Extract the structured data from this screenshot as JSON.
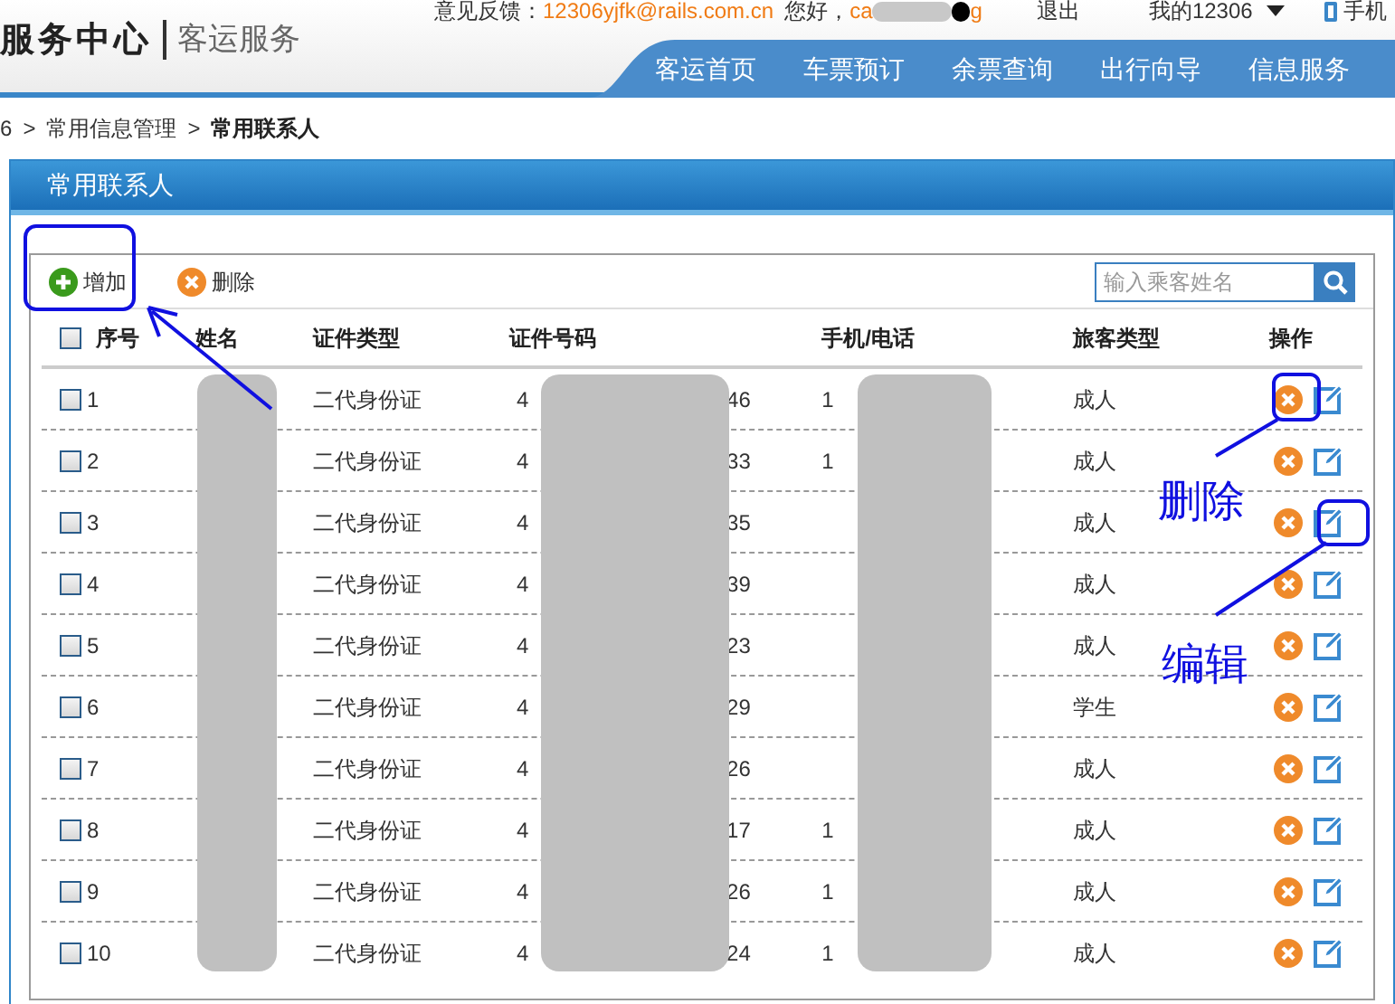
{
  "header": {
    "brand": "服务中心",
    "subtitle": "客运服务",
    "feedback_label": "意见反馈：",
    "feedback_email": "12306yjfk@rails.com.cn",
    "greeting": "您好，",
    "user_start": "ca",
    "user_end": "g",
    "logout": "退出",
    "my_account": "我的12306",
    "mobile": "手机"
  },
  "nav": [
    {
      "label": "客运首页"
    },
    {
      "label": "车票预订"
    },
    {
      "label": "余票查询"
    },
    {
      "label": "出行向导"
    },
    {
      "label": "信息服务"
    }
  ],
  "breadcrumb": {
    "separator": ">",
    "items": [
      {
        "label": "6",
        "current": false
      },
      {
        "label": "常用信息管理",
        "current": false
      },
      {
        "label": "常用联系人",
        "current": true
      }
    ]
  },
  "panel": {
    "title": "常用联系人"
  },
  "toolbar": {
    "add": "增加",
    "delete": "删除",
    "search": {
      "placeholder": "输入乘客姓名"
    }
  },
  "table": {
    "select_all_checked": false,
    "columns": [
      "序号",
      "姓名",
      "证件类型",
      "证件号码",
      "手机/电话",
      "旅客类型",
      "操作"
    ],
    "rows": [
      {
        "no": "1",
        "checked": false,
        "id_type": "二代身份证",
        "id_start": "4",
        "id_end": "46",
        "phone_start": "1",
        "passenger_type": "成人"
      },
      {
        "no": "2",
        "checked": false,
        "id_type": "二代身份证",
        "id_start": "4",
        "id_end": "33",
        "phone_start": "1",
        "passenger_type": "成人"
      },
      {
        "no": "3",
        "checked": false,
        "id_type": "二代身份证",
        "id_start": "4",
        "id_end": "35",
        "passenger_type": "成人"
      },
      {
        "no": "4",
        "checked": false,
        "id_type": "二代身份证",
        "id_start": "4",
        "id_end": "39",
        "passenger_type": "成人"
      },
      {
        "no": "5",
        "checked": false,
        "id_type": "二代身份证",
        "id_start": "4",
        "id_end": "23",
        "passenger_type": "成人"
      },
      {
        "no": "6",
        "checked": false,
        "id_type": "二代身份证",
        "id_start": "4",
        "id_end": "29",
        "passenger_type": "学生"
      },
      {
        "no": "7",
        "checked": false,
        "id_type": "二代身份证",
        "id_start": "4",
        "id_end": "26",
        "passenger_type": "成人"
      },
      {
        "no": "8",
        "checked": false,
        "id_type": "二代身份证",
        "id_start": "4",
        "id_end": "17",
        "phone_start": "1",
        "passenger_type": "成人"
      },
      {
        "no": "9",
        "checked": false,
        "id_type": "二代身份证",
        "id_start": "4",
        "id_end": "26",
        "phone_start": "1",
        "passenger_type": "成人"
      },
      {
        "no": "10",
        "checked": false,
        "id_type": "二代身份证",
        "id_start": "4",
        "id_end": "24",
        "phone_start": "1",
        "passenger_type": "成人"
      }
    ]
  },
  "annotations": {
    "delete_label": "删除",
    "edit_label": "编辑"
  }
}
